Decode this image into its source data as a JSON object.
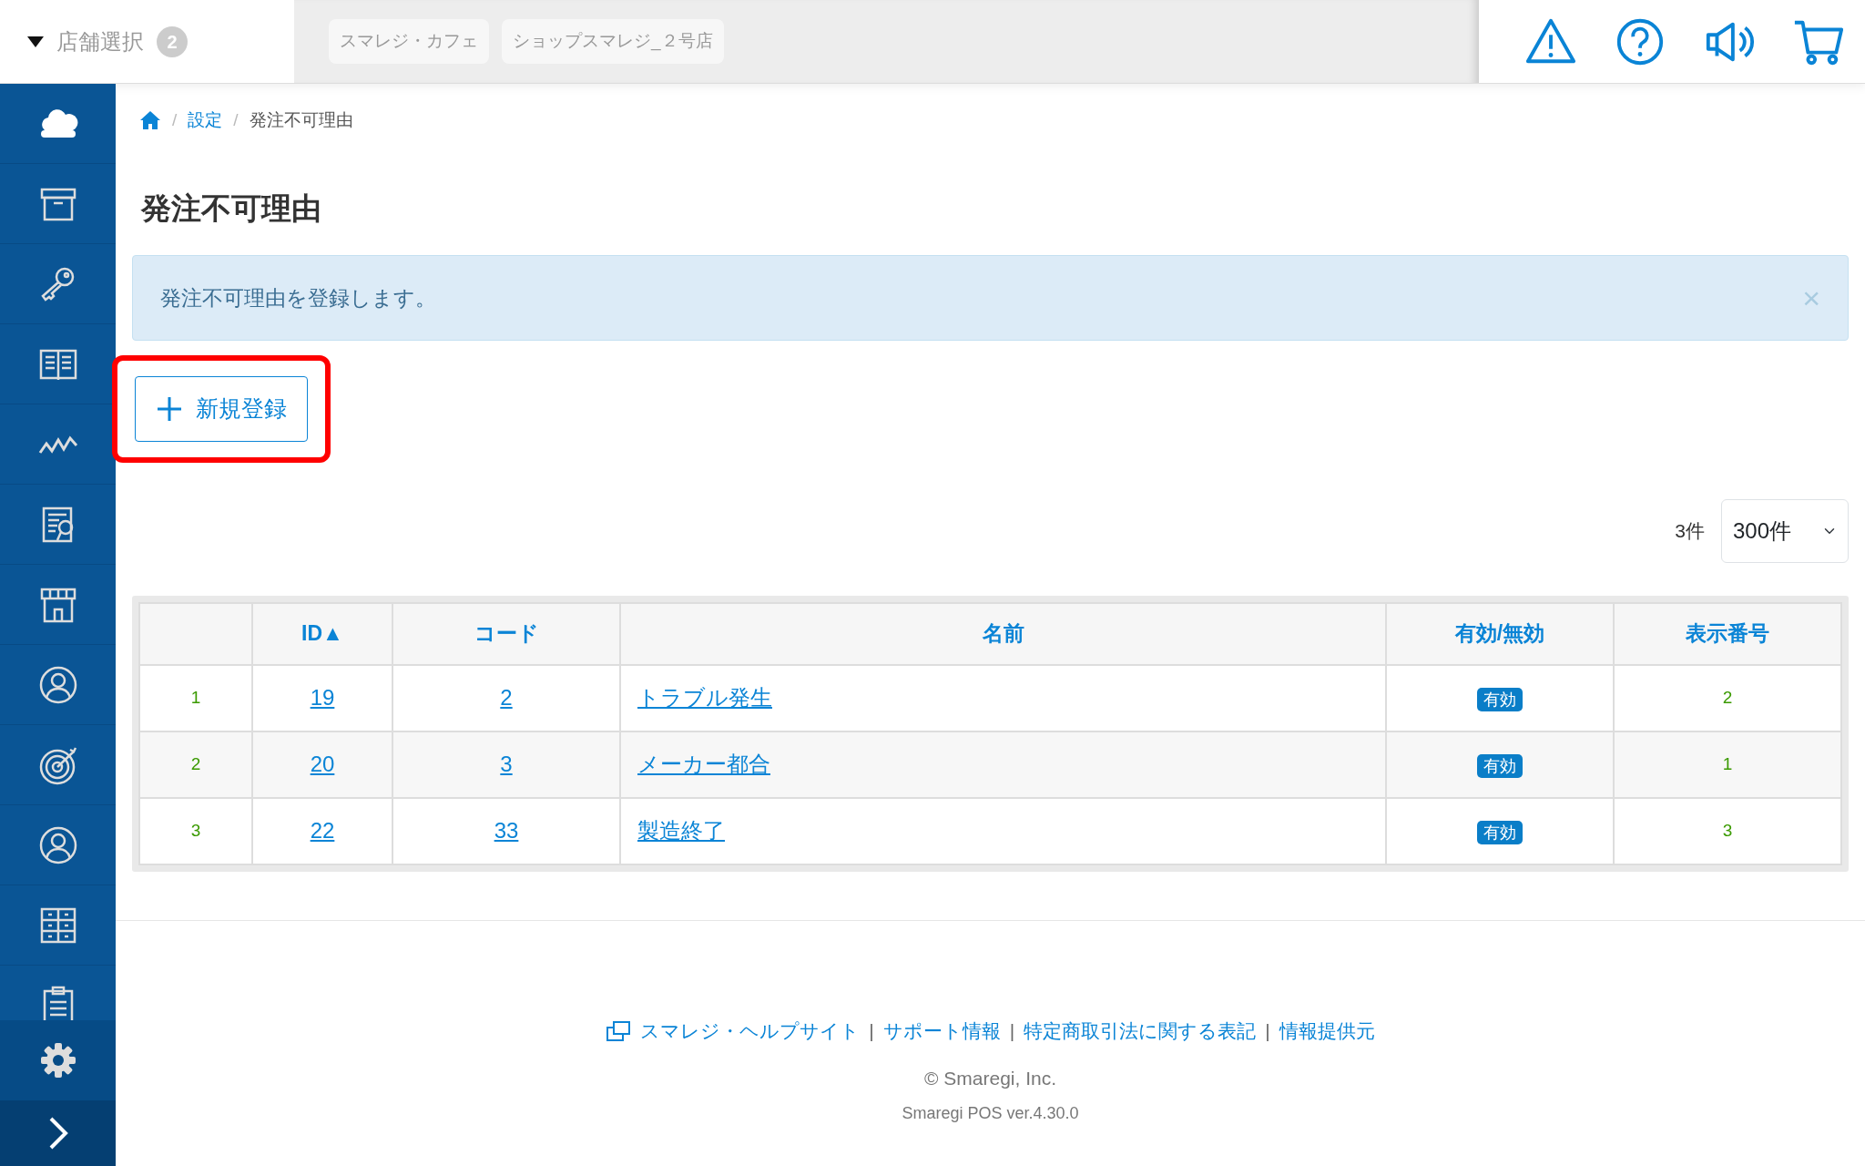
{
  "header": {
    "store_selector": {
      "label": "店舗選択",
      "count": "2"
    },
    "stores": [
      "スマレジ・カフェ",
      "ショップスマレジ_２号店"
    ]
  },
  "breadcrumb": [
    {
      "separator": "/",
      "label": "設定",
      "kind": "link"
    },
    {
      "separator": "/",
      "label": "発注不可理由",
      "kind": "current"
    }
  ],
  "page_title": "発注不可理由",
  "alert": {
    "text": "発注不可理由を登録します。",
    "close": "×"
  },
  "new_button": {
    "label": "新規登録",
    "highlighted": true
  },
  "count": "3件",
  "page_size": {
    "value": "300件"
  },
  "table": {
    "columns": [
      "",
      "ID▲",
      "コード",
      "名前",
      "有効/無効",
      "表示番号"
    ],
    "rows": [
      {
        "index": "1",
        "id": "19",
        "code": "2",
        "name": "トラブル発生",
        "status": "有効",
        "order": "2"
      },
      {
        "index": "2",
        "id": "20",
        "code": "3",
        "name": "メーカー都合",
        "status": "有効",
        "order": "1"
      },
      {
        "index": "3",
        "id": "22",
        "code": "33",
        "name": "製造終了",
        "status": "有効",
        "order": "3"
      }
    ]
  },
  "footer": {
    "links": [
      {
        "label": "スマレジ・ヘルプサイト"
      },
      {
        "separator": "|",
        "label": "サポート情報"
      },
      {
        "separator": "|",
        "label": "特定商取引法に関する表記"
      },
      {
        "separator": "|",
        "label": "情報提供元"
      }
    ],
    "copyright": "© Smaregi, Inc.",
    "version": "Smaregi POS ver.4.30.0"
  }
}
